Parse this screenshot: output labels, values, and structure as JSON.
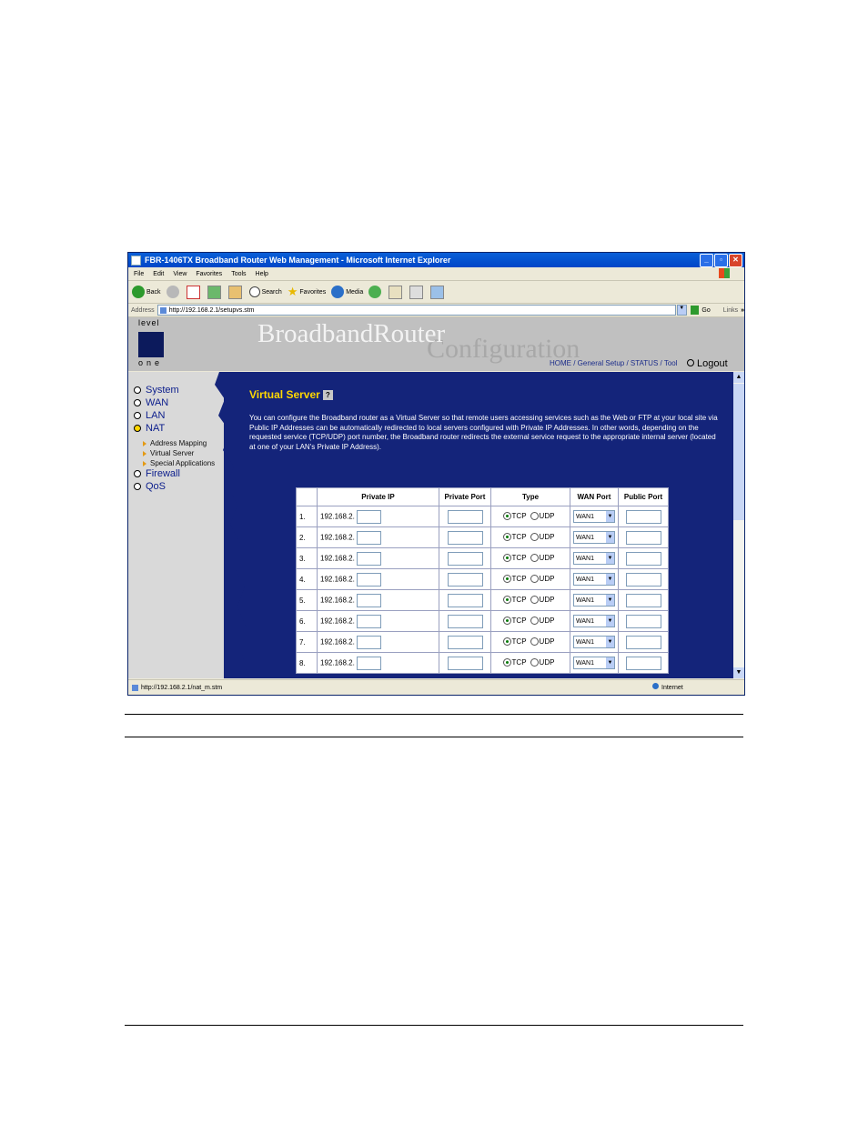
{
  "window": {
    "title": "FBR-1406TX Broadband Router Web Management - Microsoft Internet Explorer",
    "minimize": "_",
    "maximize": "▫",
    "close": "✕"
  },
  "menu": [
    "File",
    "Edit",
    "View",
    "Favorites",
    "Tools",
    "Help"
  ],
  "toolbar": {
    "back": "Back",
    "search": "Search",
    "favorites": "Favorites",
    "media": "Media"
  },
  "address": {
    "label": "Address",
    "url": "http://192.168.2.1/setupvs.stm",
    "go": "Go",
    "links": "Links",
    "links_chevron": "»"
  },
  "header": {
    "logo_top": "level",
    "logo_bottom": "one",
    "brand_main": "BroadbandRouter",
    "brand_sub": "Configuration",
    "nav": "HOME / General Setup / STATUS / Tool",
    "logout": "Logout"
  },
  "sidebar": {
    "items": [
      "System",
      "WAN",
      "LAN",
      "NAT",
      "Firewall",
      "QoS"
    ],
    "nat_sub": [
      "Address Mapping",
      "Virtual Server",
      "Special Applications"
    ]
  },
  "page": {
    "title": "Virtual Server",
    "help": "?",
    "description": "You can configure the Broadband router as a Virtual Server so that remote users accessing services such as the Web or FTP at your local site via Public IP Addresses can be automatically redirected to local servers configured with Private IP Addresses. In other words, depending on the requested service (TCP/UDP) port number, the Broadband router redirects the external service request to the appropriate internal server (located at one of your LAN's Private IP Address)."
  },
  "table": {
    "headers": [
      "",
      "Private IP",
      "Private Port",
      "Type",
      "WAN Port",
      "Public Port"
    ],
    "ip_prefix": "192.168.2.",
    "tcp": "TCP",
    "udp": "UDP",
    "wan_value": "WAN1",
    "rows": [
      "1.",
      "2.",
      "3.",
      "4.",
      "5.",
      "6.",
      "7.",
      "8."
    ]
  },
  "statusbar": {
    "url": "http://192.168.2.1/nat_m.stm",
    "zone": "Internet"
  }
}
